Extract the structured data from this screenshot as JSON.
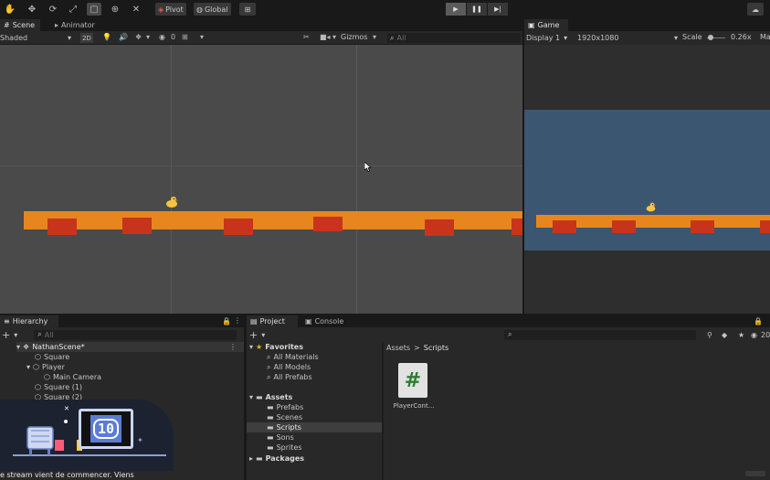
{
  "toolbar": {
    "pivot_label": "Pivot",
    "global_label": "Global",
    "tools": [
      "hand-tool",
      "move-tool",
      "rotate-tool",
      "scale-tool",
      "rect-tool",
      "transform-tool",
      "custom-tool"
    ]
  },
  "scene": {
    "tab_scene": "Scene",
    "tab_animator": "Animator",
    "shading_mode": "Shaded",
    "mode_2d": "2D",
    "layers_count": "0",
    "gizmos_label": "Gizmos",
    "search_placeholder": "All"
  },
  "game": {
    "tab_label": "Game",
    "display": "Display 1",
    "resolution": "1920x1080",
    "scale_label": "Scale",
    "scale_value": "0.26x",
    "maximize_partial": "Ma"
  },
  "hierarchy": {
    "tab_label": "Hierarchy",
    "search_placeholder": "All",
    "items": [
      {
        "label": "NathanScene*"
      },
      {
        "label": "Square"
      },
      {
        "label": "Player"
      },
      {
        "label": "Main Camera"
      },
      {
        "label": "Square (1)"
      },
      {
        "label": "Square (2)"
      }
    ]
  },
  "project": {
    "tab_project": "Project",
    "tab_console": "Console",
    "favorites": {
      "label": "Favorites",
      "items": [
        "All Materials",
        "All Models",
        "All Prefabs"
      ]
    },
    "assets": {
      "label": "Assets",
      "folders": [
        "Prefabs",
        "Scenes",
        "Scripts",
        "Sons",
        "Sprites"
      ],
      "selected": "Scripts"
    },
    "packages_label": "Packages",
    "breadcrumb": {
      "root": "Assets",
      "separator": ">",
      "current": "Scripts"
    },
    "asset_files": [
      {
        "name": "PlayerCont...",
        "icon_glyph": "#"
      }
    ],
    "hidden_count": "20"
  },
  "overlay": {
    "ticker_text": "e stream vient de commencer. Viens",
    "tv_text": "10"
  },
  "colors": {
    "platform": "#e8861e",
    "block": "#c8341b",
    "game_bg": "#3b5670",
    "scene_bg": "#4a4a4a"
  }
}
